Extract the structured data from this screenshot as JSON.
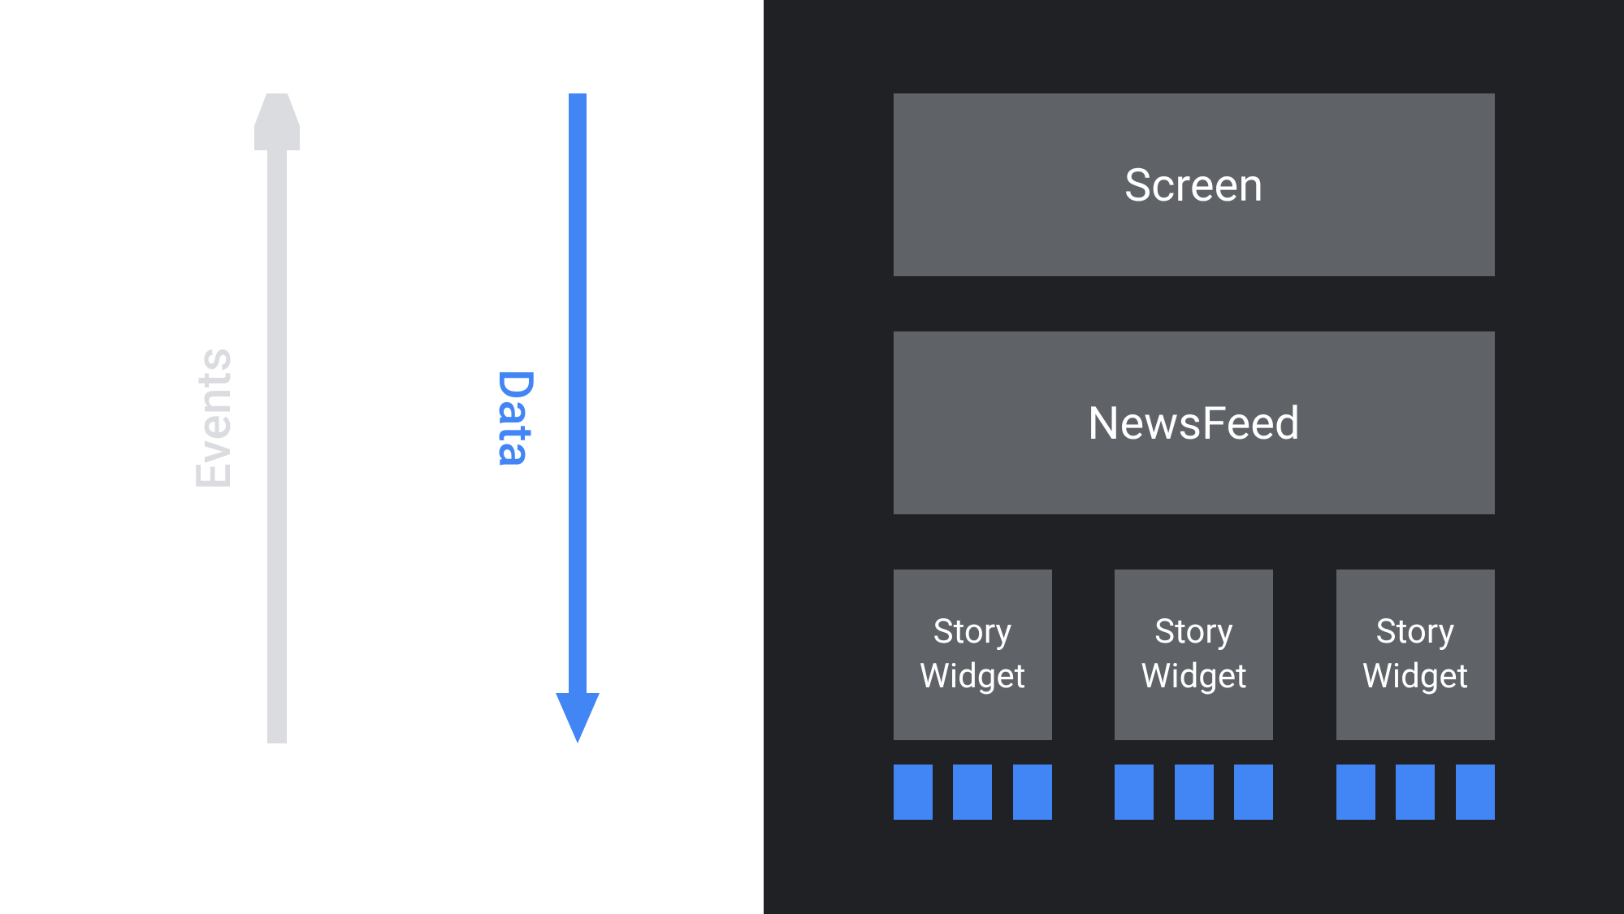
{
  "arrows": {
    "events": {
      "label": "Events",
      "color": "#dadce0",
      "direction": "up"
    },
    "data": {
      "label": "Data",
      "color": "#4285f4",
      "direction": "down"
    }
  },
  "hierarchy": {
    "screen": "Screen",
    "newsfeed": "NewsFeed",
    "widgets": [
      "Story Widget",
      "Story Widget",
      "Story Widget"
    ],
    "leaf_count_per_widget": 3
  },
  "colors": {
    "accent": "#4285f4",
    "muted": "#dadce0",
    "box": "#5f6368",
    "dark_bg": "#202124"
  }
}
